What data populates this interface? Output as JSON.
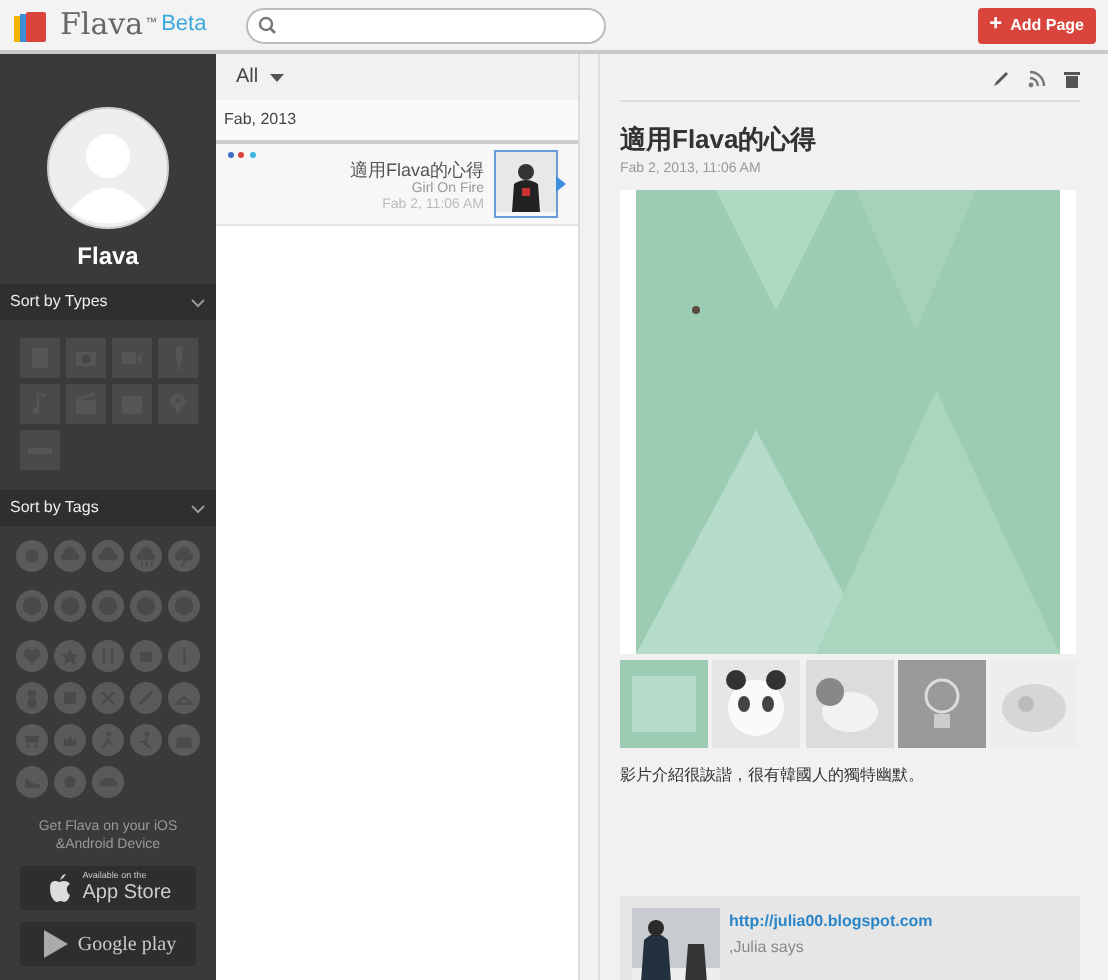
{
  "header": {
    "brand": "Flava",
    "trademark": "™",
    "edition": "Beta",
    "add_button": {
      "icon": "+",
      "label": "Add Page"
    }
  },
  "sidebar": {
    "profile_name": "Flava",
    "sections": [
      {
        "title": "Sort by Types",
        "expanded": true
      },
      {
        "title": "Sort by Tags",
        "expanded": true
      }
    ],
    "promo": "Get Flava on your iOS &Android Device",
    "stores": [
      {
        "kind": "apple",
        "caption": "Available on the",
        "label": "App Store"
      },
      {
        "kind": "google",
        "label": "Google play"
      }
    ]
  },
  "list": {
    "filter": "All",
    "group": "Fab, 2013",
    "entries": [
      {
        "dots": [
          {
            "color": "#3b6fc4"
          },
          {
            "color": "#d9453d"
          },
          {
            "color": "#3cb4e5"
          }
        ],
        "title": "適用Flava的心得",
        "author": "Girl On Fire",
        "date": "Fab 2, 11:06 AM",
        "selected": true
      }
    ]
  },
  "detail": {
    "title": "適用Flava的心得",
    "date": "Fab 2, 2013, 11:06 AM",
    "description": "影片介紹很詼諧，很有韓國人的獨特幽默。",
    "comment": {
      "link": "http://julia00.blogspot.com",
      "author": ",Julia says"
    }
  }
}
